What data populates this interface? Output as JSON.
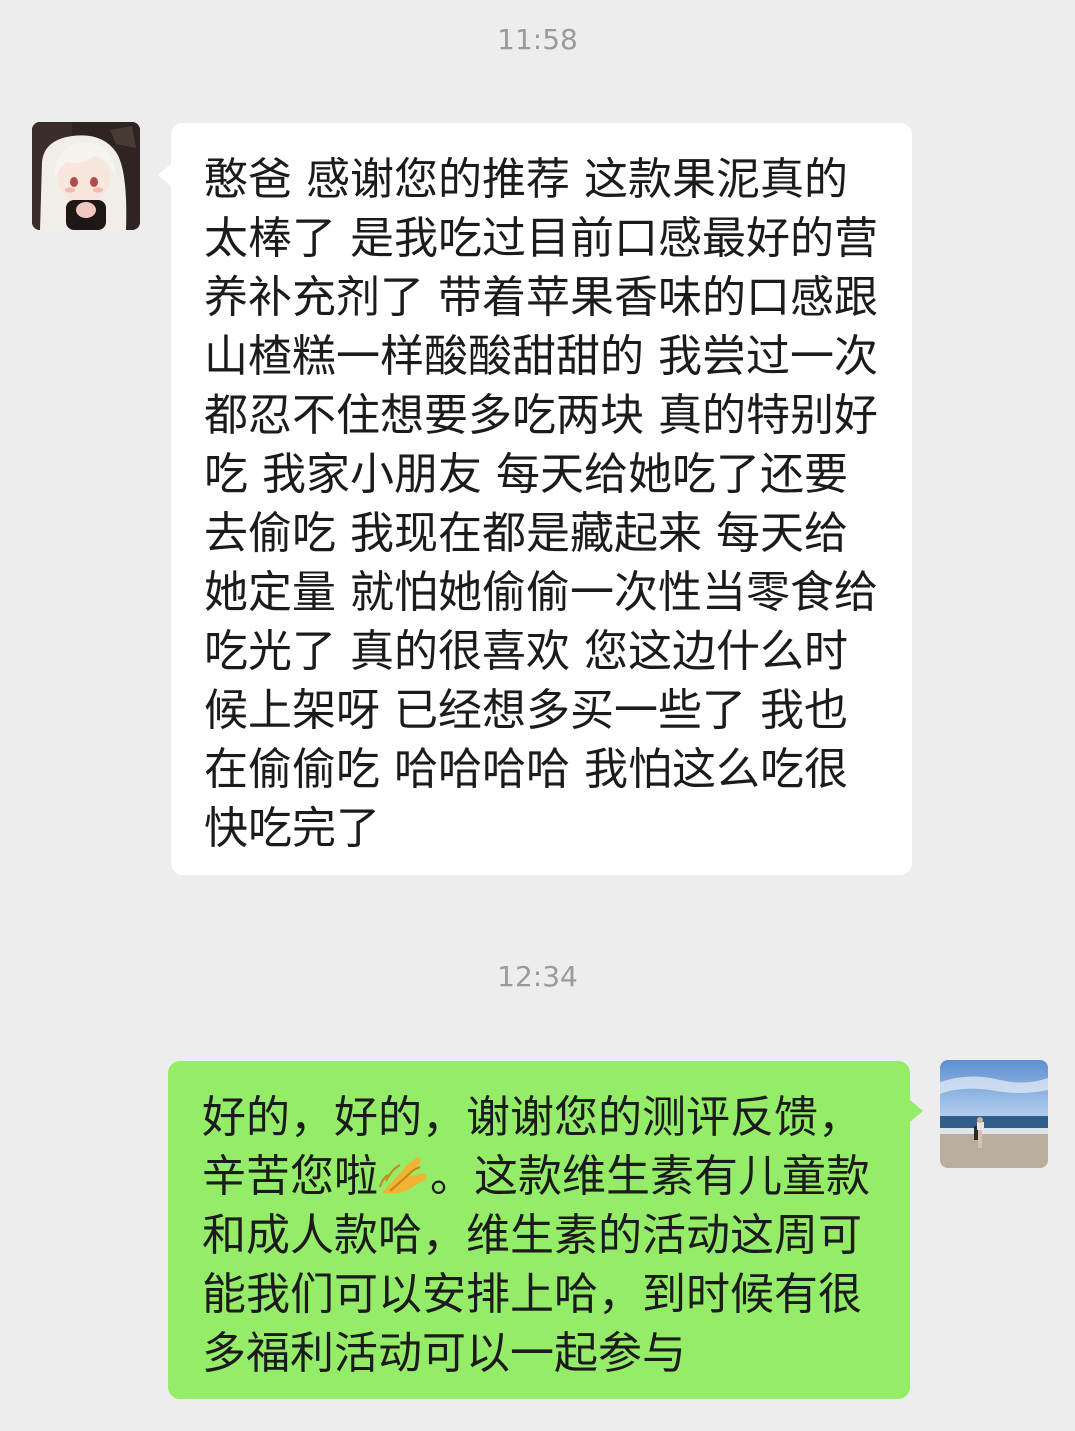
{
  "chat": {
    "messages": [
      {
        "time": "11:58",
        "sender": "other",
        "avatar_icon": "anime-girl-avatar",
        "text": "憨爸 感谢您的推荐 这款果泥真的太棒了 是我吃过目前口感最好的营养补充剂了 带着苹果香味的口感跟山楂糕一样酸酸甜甜的 我尝过一次都忍不住想要多吃两块 真的特别好吃 我家小朋友 每天给她吃了还要去偷吃 我现在都是藏起来 每天给她定量 就怕她偷偷一次性当零食给吃光了 真的很喜欢 您这边什么时候上架呀 已经想多买一些了 我也在偷偷吃 哈哈哈哈 我怕这么吃很快吃完了"
      },
      {
        "time": "12:34",
        "sender": "self",
        "avatar_icon": "beach-photo-avatar",
        "text_before_emoji": "好的，好的，谢谢您的测评反馈，辛苦您啦",
        "emoji_icon": "praying-hands-icon",
        "text_after_emoji": "。这款维生素有儿童款和成人款哈，维生素的活动这周可能我们可以安排上哈，到时候有很多福利活动可以一起参与"
      }
    ]
  },
  "colors": {
    "background": "#ededed",
    "incoming_bubble": "#ffffff",
    "outgoing_bubble": "#95ec69",
    "timestamp_text": "#9a9a9a",
    "message_text": "#1b1b1b"
  }
}
